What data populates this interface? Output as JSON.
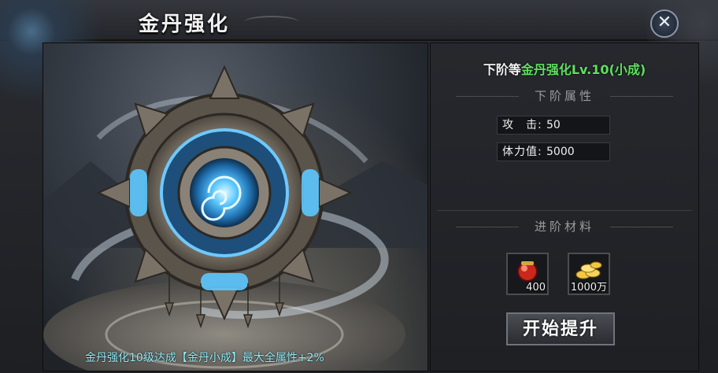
{
  "window": {
    "title": "金丹强化",
    "close_symbol": "✕"
  },
  "rank": {
    "prefix": "下阶等",
    "value": "金丹强化Lv.10(小成)"
  },
  "next_attributes": {
    "heading": "下阶属性",
    "stats": [
      {
        "label": "攻　击:",
        "value": "50"
      },
      {
        "label": "体力值:",
        "value": "5000"
      }
    ]
  },
  "materials": {
    "heading": "进阶材料",
    "items": [
      {
        "icon": "red-pill-icon",
        "count": "400"
      },
      {
        "icon": "gold-coins-icon",
        "count": "1000万"
      }
    ]
  },
  "upgrade_button": "开始提升",
  "footer_note": "金丹强化10级达成【金丹小成】最大全属性+2%",
  "colors": {
    "rank_value": "#5fe05f",
    "footer_note": "#8fe9f5",
    "orb_glow": "#38b6ff"
  }
}
